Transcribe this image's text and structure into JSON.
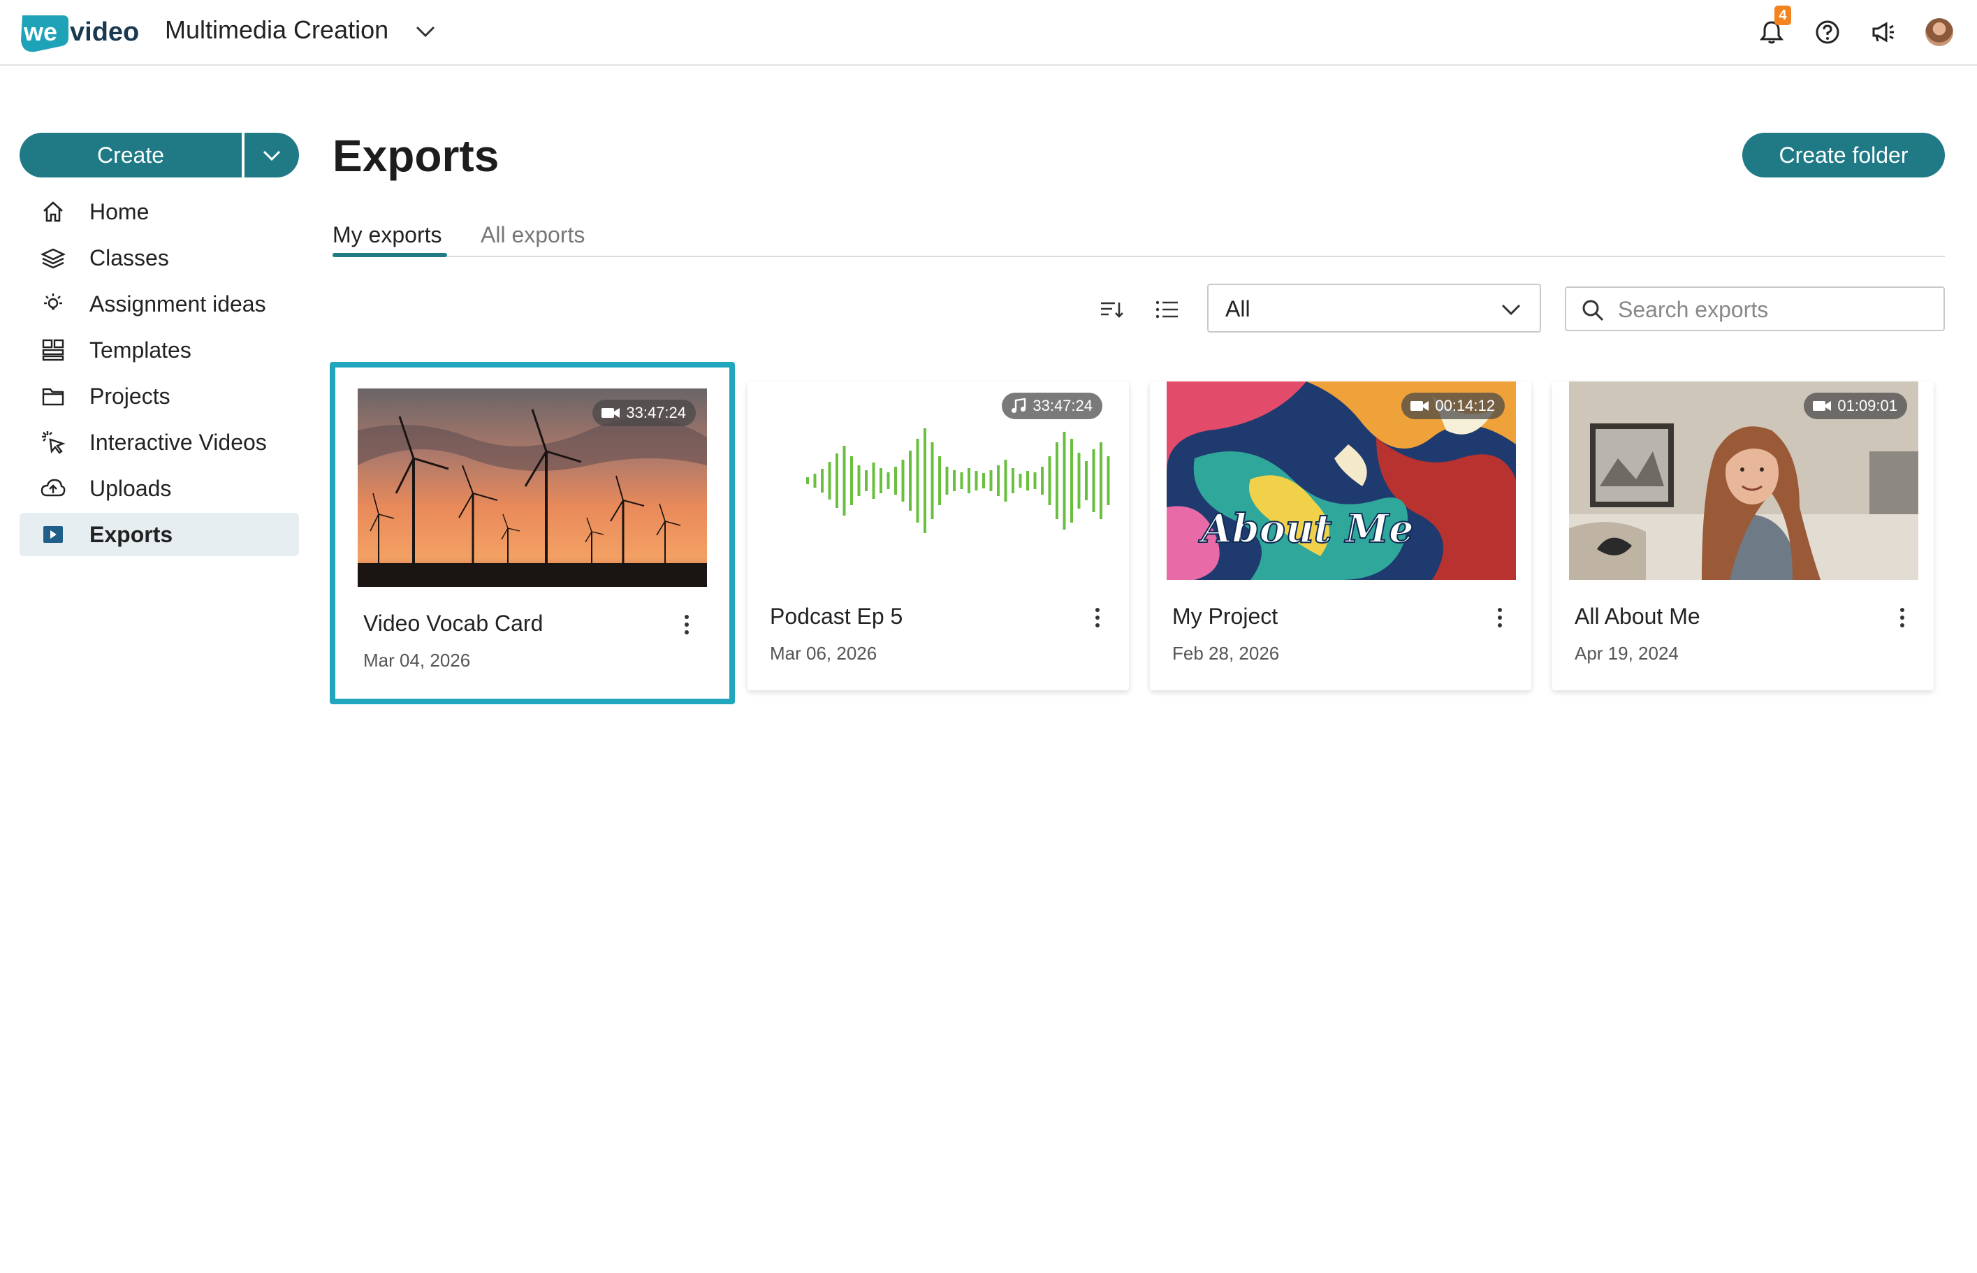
{
  "header": {
    "logo_text": "wevideo",
    "workspace_name": "Multimedia Creation",
    "notification_count": "4"
  },
  "sidebar": {
    "create_label": "Create",
    "items": [
      {
        "label": "Home",
        "icon": "home-icon"
      },
      {
        "label": "Classes",
        "icon": "classes-icon"
      },
      {
        "label": "Assignment ideas",
        "icon": "lightbulb-icon"
      },
      {
        "label": "Templates",
        "icon": "templates-icon"
      },
      {
        "label": "Projects",
        "icon": "folder-icon"
      },
      {
        "label": "Interactive Videos",
        "icon": "cursor-click-icon"
      },
      {
        "label": "Uploads",
        "icon": "cloud-upload-icon"
      },
      {
        "label": "Exports",
        "icon": "play-square-icon",
        "active": true
      }
    ]
  },
  "main": {
    "title": "Exports",
    "create_folder_label": "Create folder",
    "tabs": [
      {
        "label": "My exports",
        "active": true
      },
      {
        "label": "All exports",
        "active": false
      }
    ],
    "filter": {
      "selected": "All"
    },
    "search": {
      "placeholder": "Search exports",
      "value": ""
    },
    "cards": [
      {
        "title": "Video Vocab Card",
        "date": "Mar 04, 2026",
        "duration": "33:47:24",
        "media": "video",
        "selected": true
      },
      {
        "title": "Podcast Ep 5",
        "date": "Mar 06, 2026",
        "duration": "33:47:24",
        "media": "audio",
        "selected": false
      },
      {
        "title": "My Project",
        "date": "Feb 28, 2026",
        "duration": "00:14:12",
        "media": "video",
        "selected": false,
        "thumb_text": "About Me"
      },
      {
        "title": "All About Me",
        "date": "Apr 19, 2024",
        "duration": "01:09:01",
        "media": "video",
        "selected": false
      }
    ]
  },
  "colors": {
    "accent": "#1f7a86",
    "selection": "#22a6bd",
    "badge": "#f2831f",
    "waveform": "#6abf3f"
  }
}
